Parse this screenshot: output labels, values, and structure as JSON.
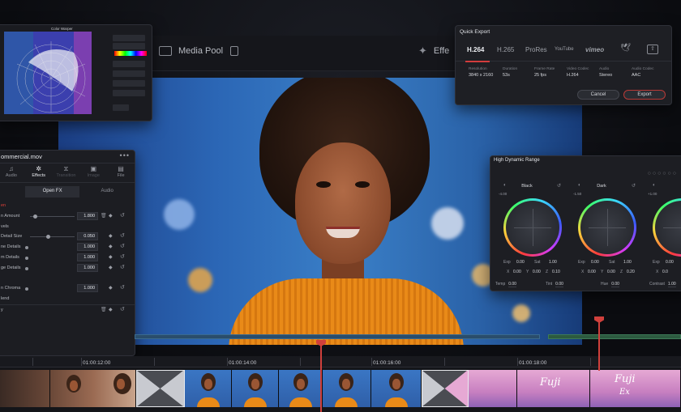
{
  "top_bar": {
    "media_pool_label": "Media Pool",
    "effects_label": "Effe"
  },
  "warper": {
    "title": "Color Warper"
  },
  "inspector": {
    "clip_name": "ommercial.mov",
    "menu": "•••",
    "tabs": [
      {
        "label": "Audio",
        "icon": "♫"
      },
      {
        "label": "Effects",
        "icon": "✲"
      },
      {
        "label": "Transition",
        "icon": "⧖"
      },
      {
        "label": "Image",
        "icon": "▣"
      },
      {
        "label": "File",
        "icon": "▤"
      }
    ],
    "sub_tabs": [
      "Open FX",
      "Audio"
    ],
    "rows": [
      {
        "label": "en",
        "red": true
      },
      {
        "label": "n Amount",
        "value": "1.800"
      },
      {
        "label": "vels"
      },
      {
        "label": "Detail Size",
        "value": "0.050"
      },
      {
        "label": "ne Details",
        "value": "1.000"
      },
      {
        "label": "m Details",
        "value": "1.000"
      },
      {
        "label": "ge Details",
        "value": "1.000"
      },
      {
        "label": ""
      },
      {
        "label": "n Chroma",
        "value": "1.000"
      },
      {
        "label": "lend"
      },
      {
        "label": "y"
      }
    ]
  },
  "quick_export": {
    "title": "Quick Export",
    "formats": [
      "H.264",
      "H.265",
      "ProRes",
      "YouTube",
      "vimeo",
      "twitter-icon",
      "upload-icon"
    ],
    "meta": [
      {
        "label": "Resolution",
        "value": "3840 x 2160"
      },
      {
        "label": "Duration",
        "value": "53s"
      },
      {
        "label": "Frame Rate",
        "value": "25 fps"
      },
      {
        "label": "Video Codec",
        "value": "H.264"
      },
      {
        "label": "Audio",
        "value": "Stereo"
      },
      {
        "label": "Audio Codec",
        "value": "AAC"
      }
    ],
    "cancel": "Cancel",
    "export": "Export"
  },
  "hdr": {
    "title": "High Dynamic Range",
    "dots": "○○○○○○",
    "wheels": [
      {
        "name": "Black",
        "top_val": "-4.00",
        "exp": "0.00",
        "sat": "1.00",
        "x": "0.00",
        "y": "0.00",
        "z": "0.10"
      },
      {
        "name": "Dark",
        "top_val": "-1.50",
        "exp": "0.00",
        "sat": "1.00",
        "x": "0.00",
        "y": "0.00",
        "z": "0.20"
      },
      {
        "name": "",
        "top_val": "+1.00",
        "exp": "0.00",
        "sat": "",
        "x": "0.0",
        "y": "",
        "z": ""
      }
    ],
    "footer": [
      {
        "label": "Temp",
        "value": "0.00"
      },
      {
        "label": "Tint",
        "value": "0.00"
      },
      {
        "label": "Hue",
        "value": "0.00"
      },
      {
        "label": "Contrast",
        "value": "1.00"
      }
    ]
  },
  "timeline": {
    "timecodes": [
      "01:00:12:00",
      "01:00:14:00",
      "01:00:16:00",
      "01:00:18:00"
    ],
    "clip_texts": [
      "Fuji",
      "Fuji",
      "Ex"
    ]
  },
  "colors": {
    "accent_red": "#d0403c",
    "panel_bg": "#1e1f24",
    "sweater_orange": "#e98a18"
  }
}
